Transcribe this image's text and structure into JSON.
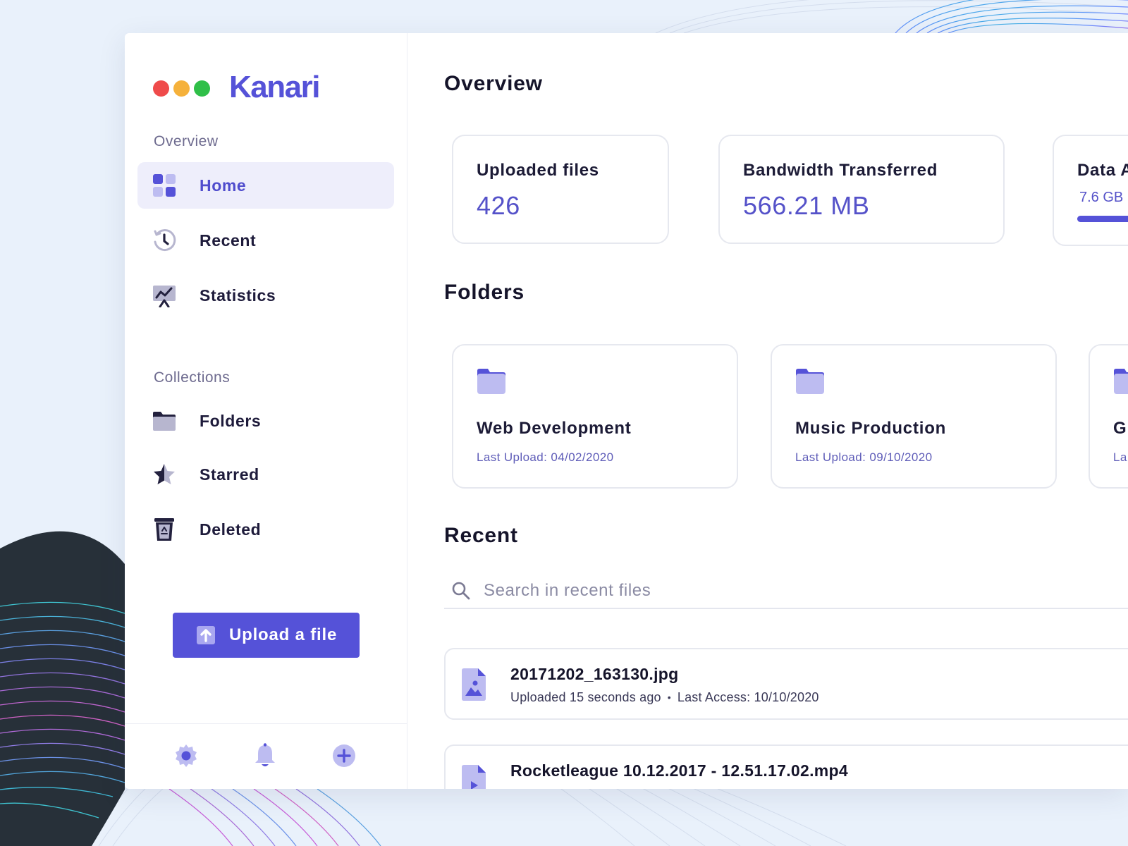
{
  "app": {
    "name": "Kanari",
    "brand_color": "#5552d8",
    "traffic_lights": [
      "#ef4b4b",
      "#f5b13b",
      "#2fbf48"
    ]
  },
  "sidebar": {
    "overview_label": "Overview",
    "overview_items": [
      {
        "label": "Home",
        "icon": "grid-icon",
        "active": true
      },
      {
        "label": "Recent",
        "icon": "clock-icon",
        "active": false
      },
      {
        "label": "Statistics",
        "icon": "chart-icon",
        "active": false
      }
    ],
    "collections_label": "Collections",
    "collection_items": [
      {
        "label": "Folders",
        "icon": "folder-icon"
      },
      {
        "label": "Starred",
        "icon": "star-icon"
      },
      {
        "label": "Deleted",
        "icon": "trash-icon"
      }
    ],
    "upload_label": "Upload a file",
    "footer_icons": [
      "gear-icon",
      "bell-icon",
      "plus-icon"
    ]
  },
  "main": {
    "overview_title": "Overview",
    "stats": [
      {
        "title": "Uploaded files",
        "value": "426"
      },
      {
        "title": "Bandwidth Transferred",
        "value": "566.21 MB"
      },
      {
        "title": "Data A",
        "value": "7.6 GB",
        "progress_fraction": 0.5
      }
    ],
    "folders_title": "Folders",
    "folders": [
      {
        "name": "Web Development",
        "last_upload": "Last Upload: 04/02/2020"
      },
      {
        "name": "Music Production",
        "last_upload": "Last Upload: 09/10/2020"
      },
      {
        "name": "G",
        "last_upload": "La"
      }
    ],
    "recent_title": "Recent",
    "search": {
      "placeholder": "Search in recent files",
      "value": ""
    },
    "files": [
      {
        "name": "20171202_163130.jpg",
        "uploaded": "Uploaded 15 seconds ago",
        "last_access": "Last Access: 10/10/2020",
        "type": "image-file-icon"
      },
      {
        "name": "Rocketleague 10.12.2017 - 12.51.17.02.mp4",
        "uploaded": "",
        "last_access": "",
        "type": "video-file-icon"
      }
    ]
  }
}
